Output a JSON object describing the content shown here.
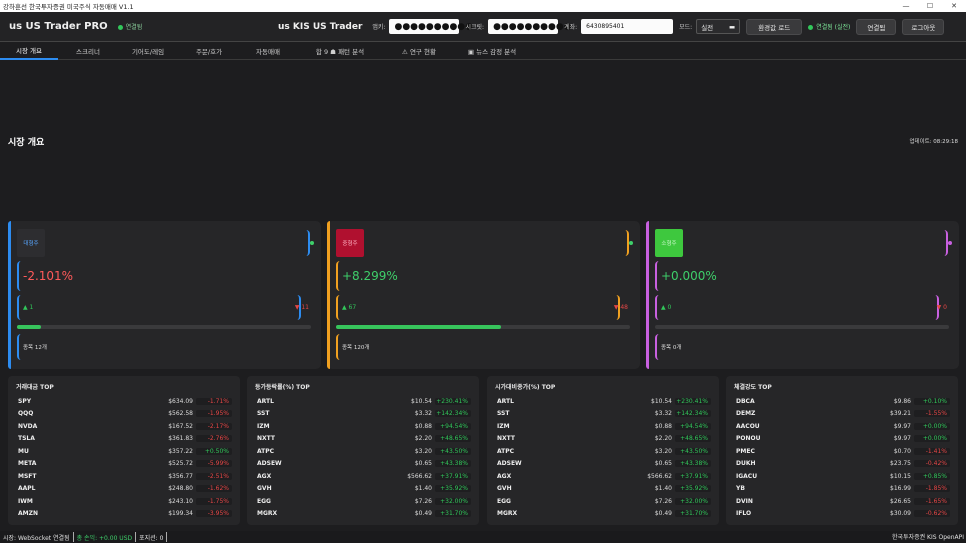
{
  "window": {
    "title": "강하훈선 한국투자증권 미국주식 자동매매 V1.1"
  },
  "header": {
    "brand": "us US Trader PRO",
    "conn_status": "연결됨",
    "kis_brand": "us KIS US Trader",
    "appkey_label": "앱키:",
    "appkey_value": "●●●●●●●●●●",
    "secret_label": "시크릿:",
    "secret_value": "●●●●●●●●●●",
    "account_label": "계좌:",
    "account_value": "6430895401",
    "mode_label": "모드:",
    "mode_value": "실전",
    "env_button": "환경값 로드",
    "live_status": "연결됨 (실전)",
    "connect_button": "연결됨",
    "logout_button": "로그아웃"
  },
  "tabs": [
    {
      "label": "시장 개요"
    },
    {
      "label": "스크리너"
    },
    {
      "label": "기어도/레임"
    },
    {
      "label": "주문/호가"
    },
    {
      "label": "자동매매"
    },
    {
      "label": "합 9 ☗ 패턴 분석"
    },
    {
      "label": "⚠ 연구 현황"
    },
    {
      "label": "▣ 뉴스 감정 분석"
    }
  ],
  "overview": {
    "title": "시장 개요",
    "updated": "업데이트: 08:29:18"
  },
  "cards": [
    {
      "name": "대형주",
      "change": "-2.101%",
      "up": "▲ 1",
      "down": "▼ 11",
      "count": "종목 12개",
      "progress": 0.083,
      "accent": "#2d8cf0",
      "badge_bg": "#2d2d30",
      "badge_fg": "#58a6ff",
      "change_color": "#ff5a5a"
    },
    {
      "name": "중형주",
      "change": "+8.299%",
      "up": "▲ 67",
      "down": "▼ 48",
      "count": "종목 120개",
      "progress": 0.56,
      "accent": "#f0a020",
      "badge_bg": "#b0102f",
      "badge_fg": "#ffb0c0",
      "change_color": "#3ecf6a"
    },
    {
      "name": "소형주",
      "change": "+0.000%",
      "up": "▲ 0",
      "down": "▼ 0",
      "count": "종목 0개",
      "progress": 0.0,
      "accent": "#c860e0",
      "badge_bg": "#3ec83e",
      "badge_fg": "#c8f7c8",
      "change_color": "#3ecf6a"
    }
  ],
  "tables": [
    {
      "title": "거래대금 TOP",
      "rows": [
        [
          "SPY",
          "$634.09",
          "-1.71%"
        ],
        [
          "QQQ",
          "$562.58",
          "-1.95%"
        ],
        [
          "NVDA",
          "$167.52",
          "-2.17%"
        ],
        [
          "TSLA",
          "$361.83",
          "-2.76%"
        ],
        [
          "MU",
          "$357.22",
          "+0.50%"
        ],
        [
          "META",
          "$525.72",
          "-5.99%"
        ],
        [
          "MSFT",
          "$356.77",
          "-2.51%"
        ],
        [
          "AAPL",
          "$248.80",
          "-1.62%"
        ],
        [
          "IWM",
          "$243.10",
          "-1.75%"
        ],
        [
          "AMZN",
          "$199.34",
          "-3.95%"
        ]
      ]
    },
    {
      "title": "등가등락률(%) TOP",
      "rows": [
        [
          "ARTL",
          "$10.54",
          "+230.41%"
        ],
        [
          "SST",
          "$3.32",
          "+142.34%"
        ],
        [
          "IZM",
          "$0.88",
          "+94.54%"
        ],
        [
          "NXTT",
          "$2.20",
          "+48.65%"
        ],
        [
          "ATPC",
          "$3.20",
          "+43.50%"
        ],
        [
          "ADSEW",
          "$0.65",
          "+43.38%"
        ],
        [
          "AGX",
          "$566.62",
          "+37.91%"
        ],
        [
          "GVH",
          "$1.40",
          "+35.92%"
        ],
        [
          "EGG",
          "$7.26",
          "+32.00%"
        ],
        [
          "MGRX",
          "$0.49",
          "+31.70%"
        ]
      ]
    },
    {
      "title": "시가대비종가(%) TOP",
      "rows": [
        [
          "ARTL",
          "$10.54",
          "+230.41%"
        ],
        [
          "SST",
          "$3.32",
          "+142.34%"
        ],
        [
          "IZM",
          "$0.88",
          "+94.54%"
        ],
        [
          "NXTT",
          "$2.20",
          "+48.65%"
        ],
        [
          "ATPC",
          "$3.20",
          "+43.50%"
        ],
        [
          "ADSEW",
          "$0.65",
          "+43.38%"
        ],
        [
          "AGX",
          "$566.62",
          "+37.91%"
        ],
        [
          "GVH",
          "$1.40",
          "+35.92%"
        ],
        [
          "EGG",
          "$7.26",
          "+32.00%"
        ],
        [
          "MGRX",
          "$0.49",
          "+31.70%"
        ]
      ]
    },
    {
      "title": "체결강도 TOP",
      "rows": [
        [
          "DBCA",
          "$9.86",
          "+0.10%"
        ],
        [
          "DEMZ",
          "$39.21",
          "-1.55%"
        ],
        [
          "AACOU",
          "$9.97",
          "+0.00%"
        ],
        [
          "PONOU",
          "$9.97",
          "+0.00%"
        ],
        [
          "PMEC",
          "$0.70",
          "-1.41%"
        ],
        [
          "DUKH",
          "$23.75",
          "-0.42%"
        ],
        [
          "IGACU",
          "$10.15",
          "+0.85%"
        ],
        [
          "YB",
          "$16.99",
          "-1.85%"
        ],
        [
          "DVIN",
          "$26.65",
          "-1.65%"
        ],
        [
          "IFLO",
          "$30.09",
          "-0.62%"
        ]
      ]
    }
  ],
  "statusbar": {
    "ws": "시장: WebSocket 연결됨",
    "pnl": "총 손익: +0.00 USD",
    "positions": "포지션: 0",
    "right": "한국투자증권 KIS OpenAPI"
  }
}
